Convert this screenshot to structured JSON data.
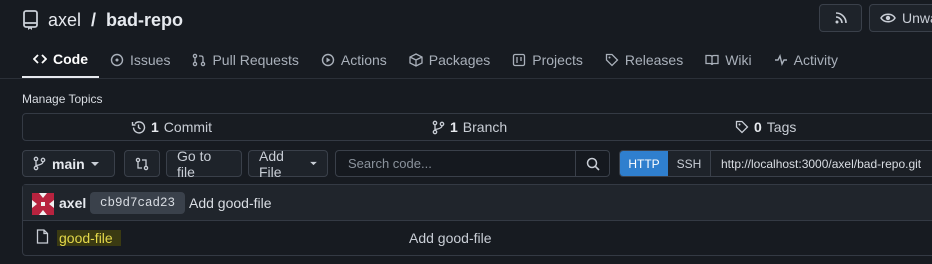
{
  "repo": {
    "owner": "axel",
    "separator": "/",
    "name": "bad-repo"
  },
  "header_buttons": {
    "unwatch_label": "Unwa"
  },
  "tabs": [
    {
      "label": "Code",
      "icon": "code-icon",
      "active": true
    },
    {
      "label": "Issues",
      "icon": "issue-icon"
    },
    {
      "label": "Pull Requests",
      "icon": "pull-request-icon"
    },
    {
      "label": "Actions",
      "icon": "play-icon"
    },
    {
      "label": "Packages",
      "icon": "package-icon"
    },
    {
      "label": "Projects",
      "icon": "project-icon"
    },
    {
      "label": "Releases",
      "icon": "tag-icon"
    },
    {
      "label": "Wiki",
      "icon": "book-icon"
    },
    {
      "label": "Activity",
      "icon": "pulse-icon"
    }
  ],
  "manage_topics": "Manage Topics",
  "stats": {
    "commits_count": "1",
    "commits_label": "Commit",
    "branches_count": "1",
    "branches_label": "Branch",
    "tags_count": "0",
    "tags_label": "Tags"
  },
  "toolbar": {
    "branch": "main",
    "go_to_file": "Go to file",
    "add_file": "Add File",
    "search_placeholder": "Search code...",
    "clone_http": "HTTP",
    "clone_ssh": "SSH",
    "clone_url": "http://localhost:3000/axel/bad-repo.git"
  },
  "latest_commit": {
    "author": "axel",
    "sha": "cb9d7cad23",
    "message": "Add good-file"
  },
  "files": [
    {
      "name": "good-file",
      "commit_message": "Add good-file"
    }
  ],
  "colors": {
    "accent": "#2f7fce",
    "highlight_text": "#e3d84a",
    "background": "#171b21"
  }
}
